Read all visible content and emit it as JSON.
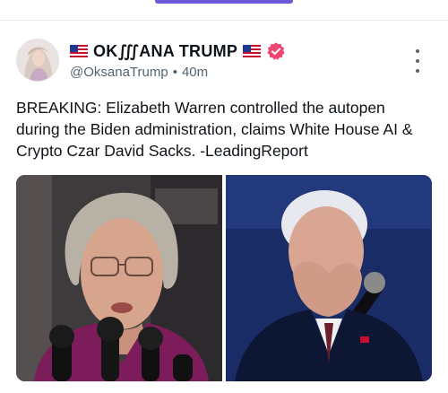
{
  "post": {
    "display_name": "OK∭ANA TRUMP",
    "handle": "@OksanaTrump",
    "separator": "•",
    "time_ago": "40m",
    "text": "BREAKING: Elizabeth Warren controlled the autopen during the Biden administration, claims White House AI & Crypto Czar David Sacks. -LeadingReport"
  },
  "icons": {
    "flag_left": "us-flag-icon",
    "flag_right": "us-flag-icon",
    "verified": "verified-badge-icon",
    "more": "more-vertical-icon"
  },
  "colors": {
    "accent": "#6b5bd6",
    "verified": "#f0466f",
    "secondary_text": "#536471"
  }
}
